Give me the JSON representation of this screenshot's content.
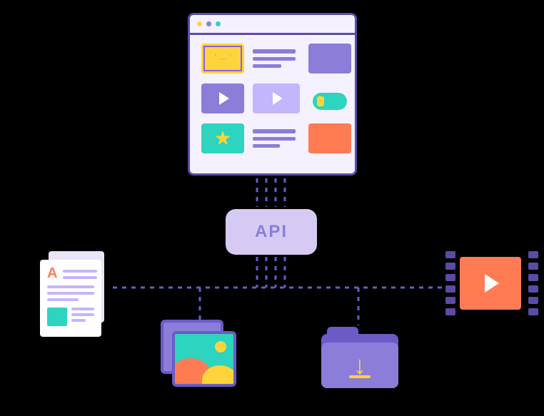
{
  "api": {
    "label": "API"
  },
  "document": {
    "letter": "A"
  },
  "colors": {
    "purple": "#8b7dd8",
    "deep_purple": "#5c4ba6",
    "lavender": "#d6caf5",
    "light_lavender": "#c4b5fd",
    "yellow": "#ffd43b",
    "teal": "#2dd4bf",
    "orange": "#ff7b54",
    "panel_bg": "#f5f1ff"
  },
  "nodes": [
    {
      "id": "app-window",
      "type": "content-grid",
      "role": "consumer"
    },
    {
      "id": "api",
      "type": "hub",
      "role": "api"
    },
    {
      "id": "document",
      "type": "text-document",
      "role": "source"
    },
    {
      "id": "images",
      "type": "image-stack",
      "role": "source"
    },
    {
      "id": "downloads",
      "type": "folder-download",
      "role": "source"
    },
    {
      "id": "video",
      "type": "film-strip",
      "role": "source"
    }
  ],
  "edges": [
    {
      "from": "app-window",
      "to": "api"
    },
    {
      "from": "api",
      "to": "document"
    },
    {
      "from": "api",
      "to": "images"
    },
    {
      "from": "api",
      "to": "downloads"
    },
    {
      "from": "api",
      "to": "video"
    }
  ]
}
